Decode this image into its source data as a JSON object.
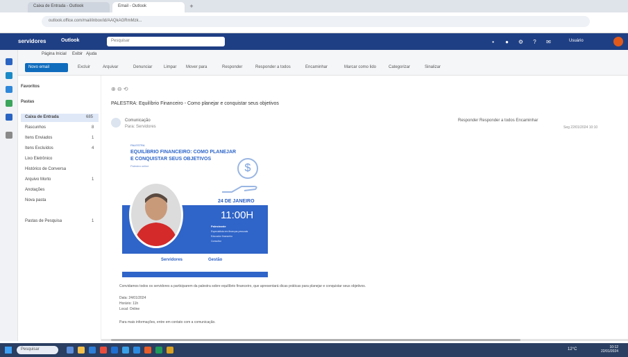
{
  "browser": {
    "tabs": [
      {
        "label": "Caixa de Entrada - Outlook"
      },
      {
        "label": "Email - Outlook"
      }
    ],
    "new_tab": "+",
    "url": "outlook.office.com/mail/inbox/id/AAQkAGRmMzk..."
  },
  "outlook": {
    "brand": "servidores",
    "app_name": "Outlook",
    "search_placeholder": "Pesquisar",
    "user_name": "Usuário",
    "ribbon_tabs": [
      "Página Inicial",
      "Exibir",
      "Ajuda"
    ],
    "new_mail": "Novo email",
    "ribbon_buttons": [
      "Excluir",
      "Arquivar",
      "Denunciar",
      "Limpar",
      "Mover para",
      "Responder",
      "Responder a todos",
      "Encaminhar",
      "Marcar como lido",
      "Categorizar",
      "Sinalizar"
    ]
  },
  "folders": {
    "favorites": "Favoritos",
    "group": "Pastas",
    "items": [
      {
        "label": "Caixa de Entrada",
        "count": "685"
      },
      {
        "label": "Rascunhos",
        "count": "8"
      },
      {
        "label": "Itens Enviados",
        "count": "1"
      },
      {
        "label": "Itens Excluídos",
        "count": "4"
      },
      {
        "label": "Lixo Eletrônico",
        "count": ""
      },
      {
        "label": "Histórico de Conversa",
        "count": ""
      },
      {
        "label": "Arquivo Morto",
        "count": "1"
      },
      {
        "label": "Anotações",
        "count": ""
      },
      {
        "label": "Nova pasta",
        "count": ""
      },
      {
        "label": "Pastas de Pesquisa",
        "count": "1"
      }
    ]
  },
  "message": {
    "subject": "PALESTRA: Equilíbrio Financeiro - Como planejar e conquistar seus objetivos",
    "sender": "Comunicação",
    "recipient": "Para: Servidores",
    "actions": "Responder  Responder a todos  Encaminhar",
    "date": "Seg 22/01/2024 10:10"
  },
  "flyer": {
    "kicker": "PALESTRA",
    "title_line1": "EQUILÍBRIO FINANCEIRO: COMO PLANEJAR",
    "title_line2": "E CONQUISTAR SEUS OBJETIVOS",
    "subtitle": "Palestra online",
    "coin": "$",
    "date": "24 DE JANEIRO",
    "time": "11:00H",
    "speaker": "Palestrante",
    "bio_lines": [
      "Especialista em finanças pessoais",
      "Educador financeiro",
      "Consultor"
    ],
    "logo1": "Servidores",
    "logo2": "Gestão"
  },
  "body": {
    "paragraph": "Convidamos todos os servidores a participarem da palestra sobre equilíbrio financeiro, que apresentará dicas práticas para planejar e conquistar seus objetivos.",
    "info_date": "Data: 24/01/2024",
    "info_time": "Horário: 11h",
    "info_place": "Local: Online",
    "closing": "Para mais informações, entre em contato com a comunicação."
  },
  "taskbar": {
    "search": "Pesquisar",
    "tray": "12°C",
    "time": "10:12",
    "date": "22/01/2024"
  },
  "colors": {
    "header": "#1f3f84",
    "accent": "#0f6cbd",
    "flyer_blue": "#2f64c8",
    "taskbar": "#2a3f62"
  }
}
